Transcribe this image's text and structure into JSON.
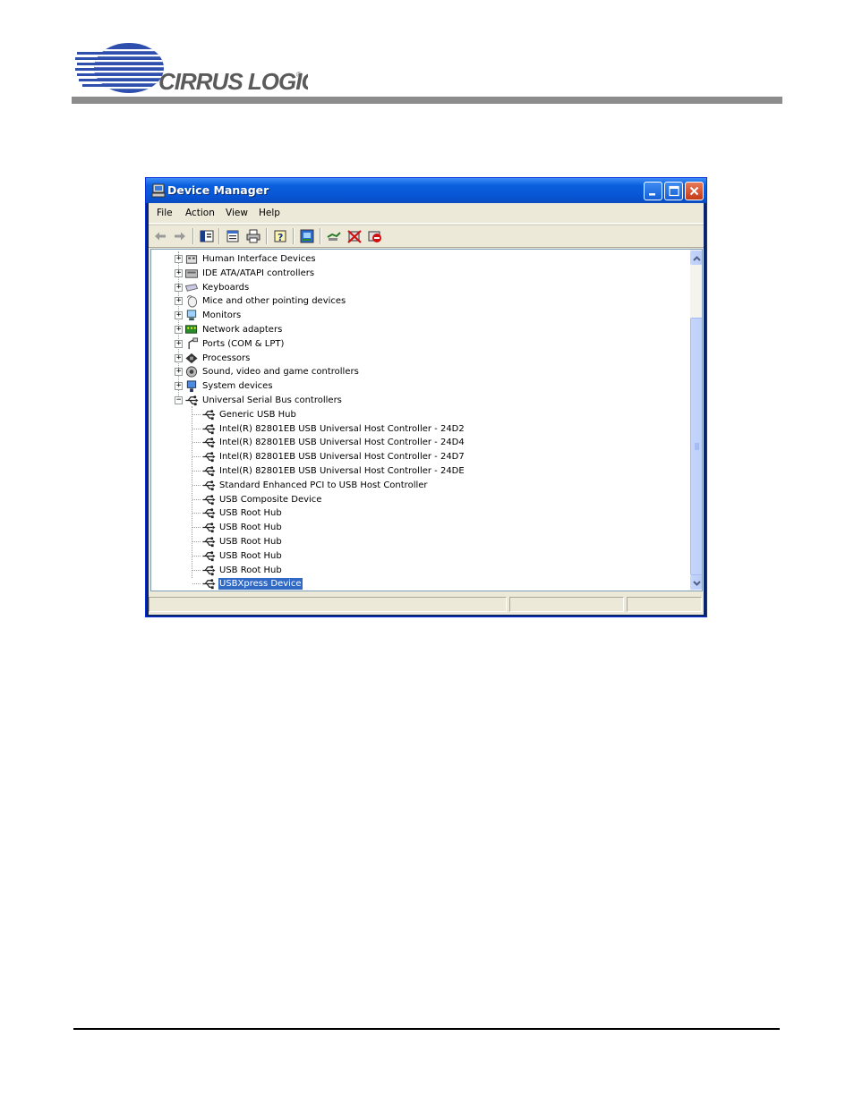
{
  "header": {
    "logo_text": "CIRRUS LOGIC",
    "logo_mark": "®"
  },
  "colors": {
    "logo_blue": "#1f3f9c",
    "rule_gray": "#8c8c8c",
    "title_blue": "#0a5fdc",
    "selection": "#316ac5"
  },
  "window": {
    "title": "Device Manager",
    "title_icon": "computer-icon",
    "controls": [
      "minimize-icon",
      "maximize-icon",
      "close-icon"
    ]
  },
  "menu": [
    "File",
    "Action",
    "View",
    "Help"
  ],
  "toolbar": [
    "back-arrow-icon",
    "forward-arrow-icon",
    "show-hide-console-tree-icon",
    "properties-icon",
    "print-icon",
    "help-icon",
    "scan-hardware-icon",
    "update-driver-icon",
    "uninstall-icon",
    "disable-icon"
  ],
  "tree": {
    "categories": [
      {
        "label": "Human Interface Devices",
        "icon": "hid-icon",
        "expanded": false
      },
      {
        "label": "IDE ATA/ATAPI controllers",
        "icon": "ide-controller-icon",
        "expanded": false
      },
      {
        "label": "Keyboards",
        "icon": "keyboard-icon",
        "expanded": false
      },
      {
        "label": "Mice and other pointing devices",
        "icon": "mouse-icon",
        "expanded": false
      },
      {
        "label": "Monitors",
        "icon": "monitor-icon",
        "expanded": false
      },
      {
        "label": "Network adapters",
        "icon": "network-adapter-icon",
        "expanded": false
      },
      {
        "label": "Ports (COM & LPT)",
        "icon": "port-icon",
        "expanded": false
      },
      {
        "label": "Processors",
        "icon": "processor-icon",
        "expanded": false
      },
      {
        "label": "Sound, video and game controllers",
        "icon": "sound-icon",
        "expanded": false
      },
      {
        "label": "System devices",
        "icon": "system-device-icon",
        "expanded": false
      },
      {
        "label": "Universal Serial Bus controllers",
        "icon": "usb-icon",
        "expanded": true
      }
    ],
    "usb_children": [
      {
        "label": "Generic USB Hub",
        "selected": false
      },
      {
        "label": "Intel(R) 82801EB USB Universal Host Controller - 24D2",
        "selected": false
      },
      {
        "label": "Intel(R) 82801EB USB Universal Host Controller - 24D4",
        "selected": false
      },
      {
        "label": "Intel(R) 82801EB USB Universal Host Controller - 24D7",
        "selected": false
      },
      {
        "label": "Intel(R) 82801EB USB Universal Host Controller - 24DE",
        "selected": false
      },
      {
        "label": "Standard Enhanced PCI to USB Host Controller",
        "selected": false
      },
      {
        "label": "USB Composite Device",
        "selected": false
      },
      {
        "label": "USB Root Hub",
        "selected": false
      },
      {
        "label": "USB Root Hub",
        "selected": false
      },
      {
        "label": "USB Root Hub",
        "selected": false
      },
      {
        "label": "USB Root Hub",
        "selected": false
      },
      {
        "label": "USB Root Hub",
        "selected": false
      },
      {
        "label": "USBXpress Device",
        "selected": true
      }
    ]
  },
  "scrollbar": {
    "position_fraction": 1.0
  }
}
